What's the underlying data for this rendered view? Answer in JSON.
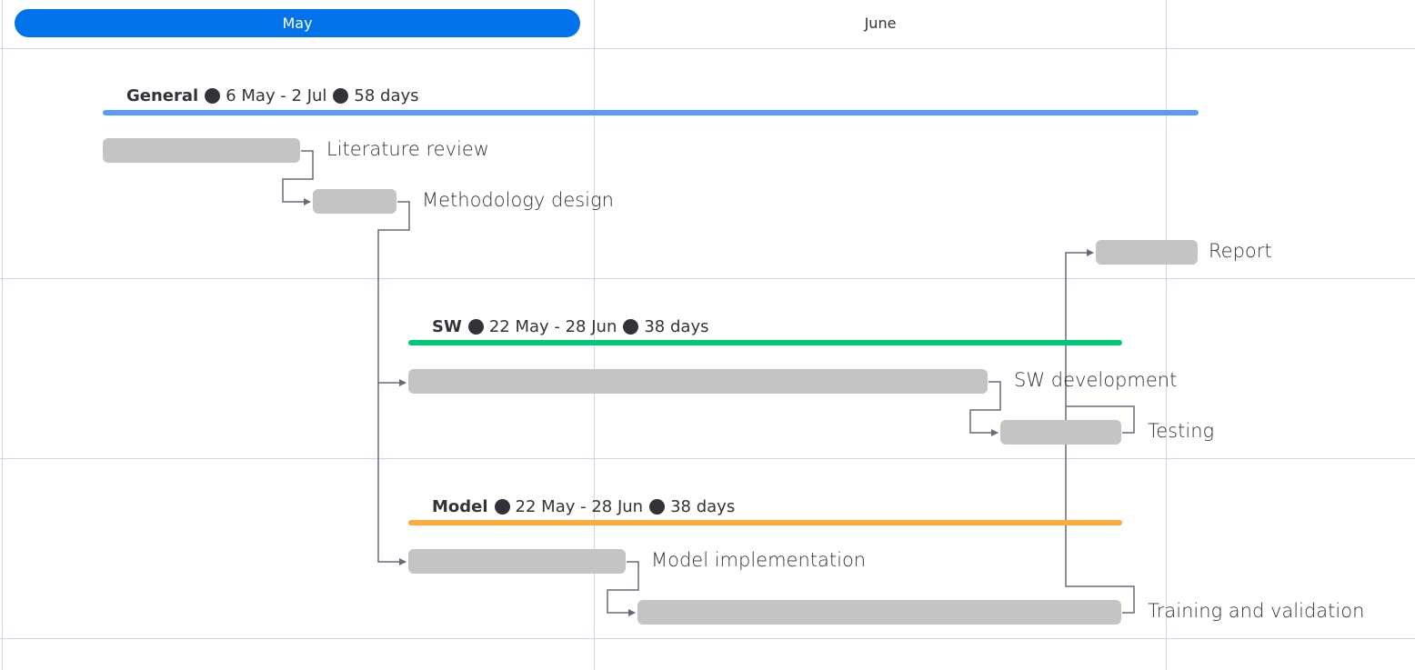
{
  "colors": {
    "accent": "#0073ea",
    "general": "#579bfc",
    "sw": "#00c875",
    "model": "#fdab3d",
    "bar": "#c4c4c4",
    "connector": "#676879"
  },
  "timeline": {
    "months": [
      {
        "label": "May",
        "active": true
      },
      {
        "label": "June",
        "active": false
      }
    ]
  },
  "groups": [
    {
      "name": "General",
      "range": "6 May - 2 Jul",
      "days": "58 days",
      "color": "#579bfc",
      "tasks": [
        {
          "label": "Literature review"
        },
        {
          "label": "Methodology design"
        },
        {
          "label": "Report"
        }
      ]
    },
    {
      "name": "SW",
      "range": "22 May - 28 Jun",
      "days": "38 days",
      "color": "#00c875",
      "tasks": [
        {
          "label": "SW development"
        },
        {
          "label": "Testing"
        }
      ]
    },
    {
      "name": "Model",
      "range": "22 May - 28 Jun",
      "days": "38 days",
      "color": "#fdab3d",
      "tasks": [
        {
          "label": "Model implementation"
        },
        {
          "label": "Training and validation"
        }
      ]
    }
  ]
}
